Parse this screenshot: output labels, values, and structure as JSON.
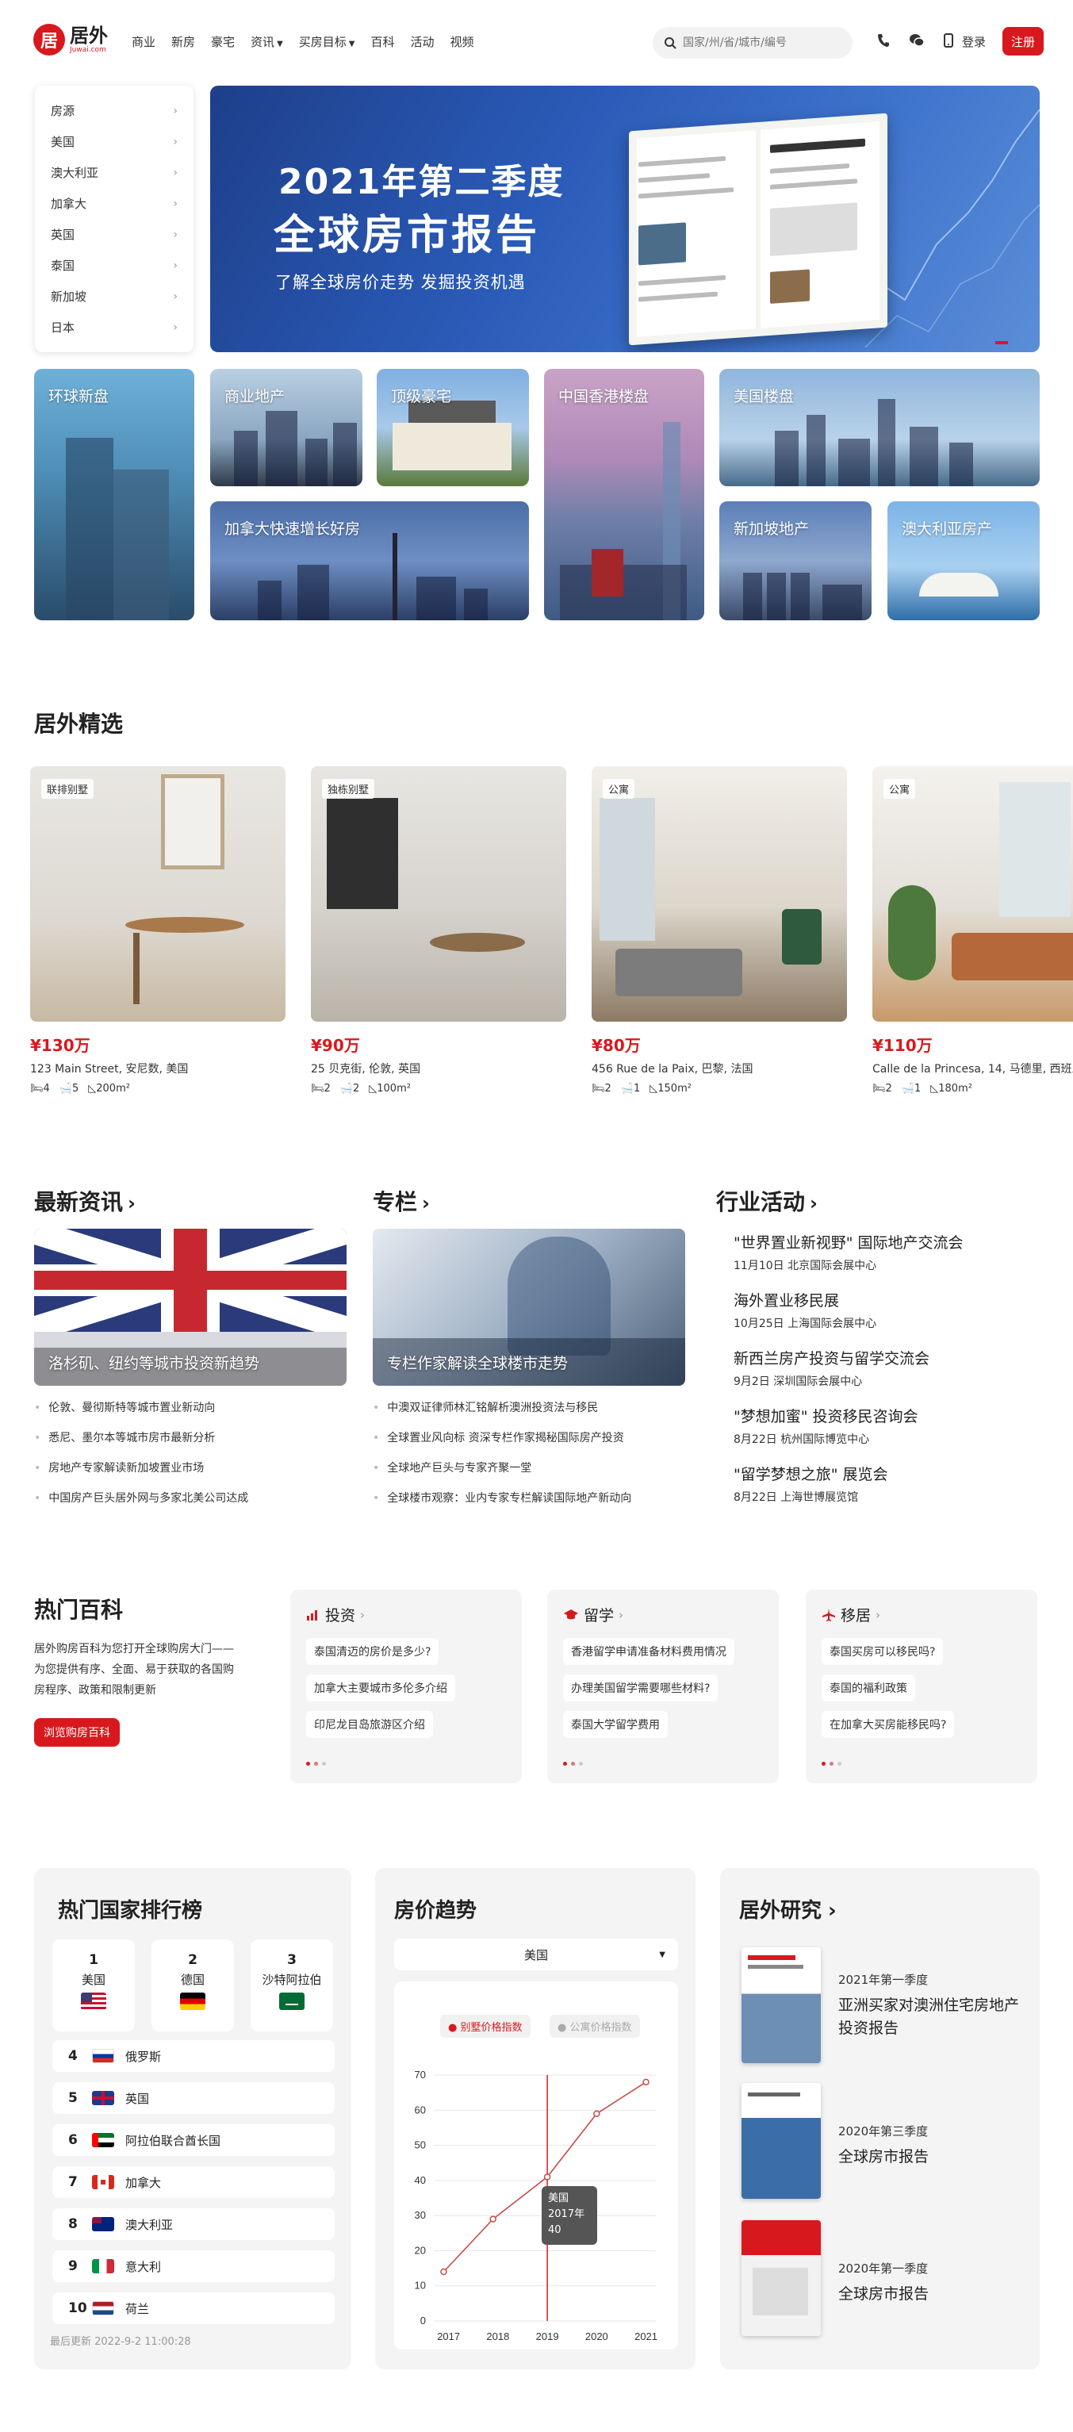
{
  "header": {
    "logo_mark": "居",
    "logo_cn": "居外",
    "logo_en": "Juwai.com",
    "nav": [
      {
        "label": "商业",
        "dropdown": false
      },
      {
        "label": "新房",
        "dropdown": false
      },
      {
        "label": "豪宅",
        "dropdown": false
      },
      {
        "label": "资讯",
        "dropdown": true
      },
      {
        "label": "买房目标",
        "dropdown": true
      },
      {
        "label": "百科",
        "dropdown": false
      },
      {
        "label": "活动",
        "dropdown": false
      },
      {
        "label": "视频",
        "dropdown": false
      }
    ],
    "search_placeholder": "国家/州/省/城市/编号",
    "login": "登录",
    "register": "注册"
  },
  "sidemenu": [
    "房源",
    "美国",
    "澳大利亚",
    "加拿大",
    "英国",
    "泰国",
    "新加坡",
    "日本"
  ],
  "banner": {
    "title1": "2021年第二季度",
    "title2": "全球房市报告",
    "subtitle": "了解全球房价走势  发掘投资机遇"
  },
  "tiles": {
    "t1": "环球新盘",
    "t2": "商业地产",
    "t3": "顶级豪宅",
    "t4": "中国香港楼盘",
    "t5": "美国楼盘",
    "t6": "加拿大快速增长好房",
    "t7": "新加坡地产",
    "t8": "澳大利亚房产"
  },
  "featured": {
    "title": "居外精选",
    "cards": [
      {
        "tag": "联排别墅",
        "price": "¥130万",
        "address": "123 Main Street, 安尼数, 美国",
        "beds": "4",
        "baths": "5",
        "area": "200m²"
      },
      {
        "tag": "独栋别墅",
        "price": "¥90万",
        "address": "25 贝克街, 伦敦, 英国",
        "beds": "2",
        "baths": "2",
        "area": "100m²"
      },
      {
        "tag": "公寓",
        "price": "¥80万",
        "address": "456 Rue de la Paix, 巴黎, 法国",
        "beds": "2",
        "baths": "1",
        "area": "150m²"
      },
      {
        "tag": "公寓",
        "price": "¥110万",
        "address": "Calle de la Princesa, 14, 马德里, 西班牙",
        "beds": "2",
        "baths": "1",
        "area": "180m²"
      }
    ]
  },
  "news": {
    "title": "最新资讯",
    "caption": "洛杉矶、纽约等城市投资新趋势",
    "items": [
      "伦敦、曼彻斯特等城市置业新动向",
      "悉尼、墨尔本等城市房市最新分析",
      "房地产专家解读新加坡置业市场",
      "中国房产巨头居外网与多家北美公司达成"
    ]
  },
  "column": {
    "title": "专栏",
    "caption": "专栏作家解读全球楼市走势",
    "items": [
      "中澳双证律师林汇铭解析澳洲投资法与移民",
      "全球置业风向标 资深专栏作家揭秘国际房产投资",
      "全球地产巨头与专家齐聚一堂",
      "全球楼市观察：业内专家专栏解读国际地产新动向"
    ]
  },
  "events": {
    "title": "行业活动",
    "items": [
      {
        "title": "\"世界置业新视野\" 国际地产交流会",
        "date": "11月10日",
        "place": "北京国际会展中心"
      },
      {
        "title": "海外置业移民展",
        "date": "10月25日",
        "place": "上海国际会展中心"
      },
      {
        "title": "新西兰房产投资与留学交流会",
        "date": "9月2日",
        "place": "深圳国际会展中心"
      },
      {
        "title": "\"梦想加蜜\" 投资移民咨询会",
        "date": "8月22日",
        "place": "杭州国际博览中心"
      },
      {
        "title": "\"留学梦想之旅\" 展览会",
        "date": "8月22日",
        "place": "上海世博展览馆"
      }
    ]
  },
  "wiki": {
    "title": "热门百科",
    "desc": "居外购房百科为您打开全球购房大门——为您提供有序、全面、易于获取的各国购房程序、政策和限制更新",
    "button": "浏览购房百科",
    "boxes": [
      {
        "head": "投资",
        "icon": "bar-chart-icon",
        "qs": [
          "泰国清迈的房价是多少?",
          "加拿大主要城市多伦多介绍",
          "印尼龙目岛旅游区介绍"
        ]
      },
      {
        "head": "留学",
        "icon": "graduation-cap-icon",
        "qs": [
          "香港留学申请准备材料费用情况",
          "办理美国留学需要哪些材料?",
          "泰国大学留学费用"
        ]
      },
      {
        "head": "移居",
        "icon": "plane-icon",
        "qs": [
          "泰国买房可以移民吗?",
          "泰国的福利政策",
          "在加拿大买房能移民吗?"
        ]
      }
    ]
  },
  "ranking": {
    "title": "热门国家排行榜",
    "top3": [
      {
        "n": "1",
        "country": "美国"
      },
      {
        "n": "2",
        "country": "德国"
      },
      {
        "n": "3",
        "country": "沙特阿拉伯"
      }
    ],
    "rows": [
      {
        "n": "4",
        "country": "俄罗斯"
      },
      {
        "n": "5",
        "country": "英国"
      },
      {
        "n": "6",
        "country": "阿拉伯联合酋长国"
      },
      {
        "n": "7",
        "country": "加拿大"
      },
      {
        "n": "8",
        "country": "澳大利亚"
      },
      {
        "n": "9",
        "country": "意大利"
      },
      {
        "n": "10",
        "country": "荷兰"
      }
    ],
    "updated": "最后更新 2022-9-2 11:00:28"
  },
  "trend": {
    "title": "房价趋势",
    "select": "美国",
    "tab_active": "别墅价格指数",
    "tab_inactive": "公寓价格指数",
    "tooltip": {
      "country": "美国",
      "year": "2017年",
      "value": "40"
    }
  },
  "chart_data": {
    "type": "line",
    "x": [
      2016.7,
      2017.5,
      2018,
      2019,
      2020,
      2021
    ],
    "values": [
      14,
      29,
      42,
      59,
      68
    ],
    "series": [
      {
        "name": "别墅价格指数",
        "x": [
          2016.9,
          2017.9,
          2019,
          2020,
          2021
        ],
        "values": [
          14,
          29,
          41,
          59,
          68
        ]
      }
    ],
    "xticks": [
      "2017",
      "2018",
      "2019",
      "2020",
      "2021"
    ],
    "yticks": [
      "0",
      "10",
      "20",
      "30",
      "40",
      "50",
      "60",
      "70"
    ],
    "ylim": [
      0,
      70
    ],
    "xlim": [
      2016.7,
      2021.2
    ],
    "highlight_x": 2019,
    "color": "#c94a4a",
    "grid": true
  },
  "research": {
    "title": "居外研究",
    "items": [
      {
        "quarter": "2021年第一季度",
        "title": "亚洲买家对澳洲住宅房地产投资报告"
      },
      {
        "quarter": "2020年第三季度",
        "title": "全球房市报告"
      },
      {
        "quarter": "2020年第一季度",
        "title": "全球房市报告"
      }
    ]
  },
  "colors": {
    "brand": "#d7191e",
    "panel": "#f4f4f4"
  }
}
